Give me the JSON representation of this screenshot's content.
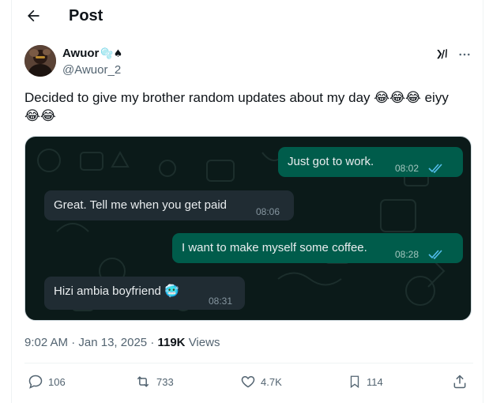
{
  "header": {
    "back_icon": "arrow-left-icon",
    "title": "Post"
  },
  "author": {
    "display_name": "Awuor",
    "name_emojis": "🫧♠",
    "handle": "@Awuor_2",
    "avatar_icon": "profile-photo"
  },
  "post": {
    "text": "Decided to give my brother random updates about my day",
    "emojis_inline": "😂😂😂",
    "text_after": " eiyy",
    "emojis_line2": "😂😂"
  },
  "chat": {
    "messages": [
      {
        "direction": "out",
        "text": "Just got to work.",
        "time": "08:02",
        "read": true
      },
      {
        "direction": "in",
        "text": "Great. Tell me when you get paid",
        "time": "08:06"
      },
      {
        "direction": "out",
        "text": "I want to make myself some coffee.",
        "time": "08:28",
        "read": true
      },
      {
        "direction": "in",
        "text": "Hizi ambia boyfriend",
        "emoji": "🥶",
        "time": "08:31"
      }
    ],
    "colors": {
      "background": "#0b1a19",
      "outgoing": "#005c4b",
      "incoming": "#202c33",
      "read_tick": "#53bdeb"
    }
  },
  "meta": {
    "time": "9:02 AM",
    "date": "Jan 13, 2025",
    "views_count": "119K",
    "views_label": "Views"
  },
  "actions": {
    "replies": "106",
    "reposts": "733",
    "likes": "4.7K",
    "bookmarks": "114"
  }
}
